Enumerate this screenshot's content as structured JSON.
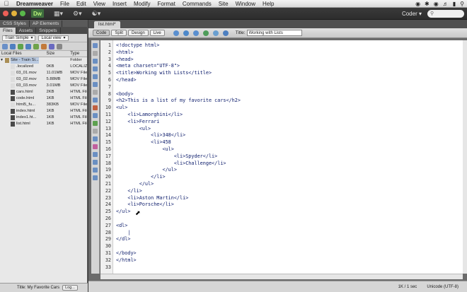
{
  "menubar": {
    "items": [
      "Dreamweaver",
      "File",
      "Edit",
      "View",
      "Insert",
      "Modify",
      "Format",
      "Commands",
      "Site",
      "Window",
      "Help"
    ],
    "apple_icon": "apple-icon"
  },
  "appbar": {
    "logo": "Dw",
    "workspace": "Coder"
  },
  "left_panel": {
    "tabs_top": [
      "CSS Styles",
      "AP Elements"
    ],
    "tabs_files": [
      "Files",
      "Assets",
      "Snippets"
    ],
    "site_select": "Train Simple",
    "view_select": "Local view",
    "columns": [
      "Local Files",
      "Size",
      "Type"
    ],
    "files": [
      {
        "name": "Site - Train Si...",
        "size": "",
        "type": "Folder"
      },
      {
        "name": ".localized",
        "size": "0KB",
        "type": "LOCALIZ..."
      },
      {
        "name": "03_01.mov",
        "size": "11.01MB",
        "type": "MOV File"
      },
      {
        "name": "03_02.mov",
        "size": "5.88MB",
        "type": "MOV File"
      },
      {
        "name": "03_03.mov",
        "size": "3.01MB",
        "type": "MOV File"
      },
      {
        "name": "cars.html",
        "size": "2KB",
        "type": "HTML File"
      },
      {
        "name": "code.html",
        "size": "1KB",
        "type": "HTML File"
      },
      {
        "name": "html5_fu...",
        "size": "383KB",
        "type": "MOV File"
      },
      {
        "name": "index.html",
        "size": "1KB",
        "type": "HTML File"
      },
      {
        "name": "index1.ht...",
        "size": "1KB",
        "type": "HTML File"
      },
      {
        "name": "list.html",
        "size": "1KB",
        "type": "HTML File"
      }
    ],
    "status_title": "Title: My Favorite Cars",
    "log_button": "Log..."
  },
  "document": {
    "tab": "list.html*",
    "views": [
      "Code",
      "Split",
      "Design",
      "Live"
    ],
    "title_label": "Title:",
    "title_value": "Working with Lists",
    "lines": [
      "<!doctype html>",
      "<html>",
      "<head>",
      "<meta charset=\"UTF-8\">",
      "<title>Working with Lists</title>",
      "</head>",
      "",
      "<body>",
      "<h2>This is a list of my favorite cars</h2>",
      "<ul>",
      "    <li>Lamorghini</li>",
      "    <li>Ferrari",
      "        <ul>",
      "            <li>348</li>",
      "            <li>458",
      "                <ul>",
      "                    <li>Spyder</li>",
      "                    <li>Challenge</li>",
      "                </ul>",
      "            </li>",
      "        </ul>",
      "    </li>",
      "    <li>Aston Martin</li>",
      "    <li>Porsche</li>",
      "</ul>",
      "",
      "<dl>",
      "    |",
      "</dl>",
      "",
      "</body>",
      "</html>",
      ""
    ],
    "status_size": "1K / 1 sec",
    "status_encoding": "Unicode (UTF-8)"
  }
}
